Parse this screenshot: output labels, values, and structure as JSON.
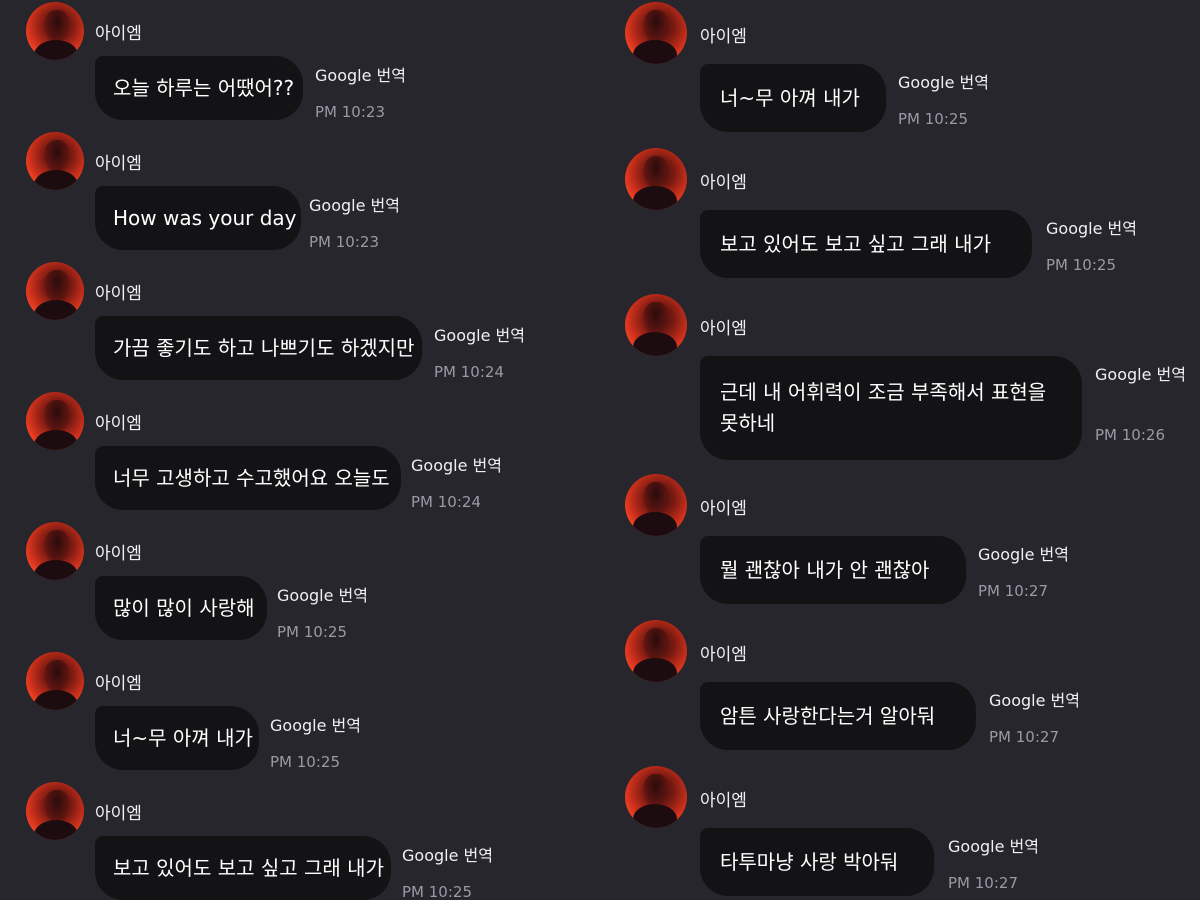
{
  "left_messages": [
    {
      "sender": "아이엠",
      "text": "오늘 하루는 어땠어??",
      "translate": "Google 번역",
      "time": "PM 10:23"
    },
    {
      "sender": "아이엠",
      "text": "How was your day",
      "translate": "Google 번역",
      "time": "PM 10:23"
    },
    {
      "sender": "아이엠",
      "text": "가끔 좋기도 하고 나쁘기도 하겠지만",
      "translate": "Google 번역",
      "time": "PM 10:24"
    },
    {
      "sender": "아이엠",
      "text": "너무 고생하고 수고했어요 오늘도",
      "translate": "Google 번역",
      "time": "PM 10:24"
    },
    {
      "sender": "아이엠",
      "text": "많이 많이 사랑해",
      "translate": "Google 번역",
      "time": "PM 10:25"
    },
    {
      "sender": "아이엠",
      "text": "너~무 아껴 내가",
      "translate": "Google 번역",
      "time": "PM 10:25"
    },
    {
      "sender": "아이엠",
      "text": "보고 있어도 보고 싶고 그래 내가",
      "translate": "Google 번역",
      "time": "PM 10:25"
    }
  ],
  "right_messages": [
    {
      "sender": "아이엠",
      "text": "너~무 아껴 내가",
      "translate": "Google 번역",
      "time": "PM 10:25"
    },
    {
      "sender": "아이엠",
      "text": "보고 있어도 보고 싶고 그래 내가",
      "translate": "Google 번역",
      "time": "PM 10:25"
    },
    {
      "sender": "아이엠",
      "text": "근데 내 어휘력이 조금 부족해서 표현을 못하네",
      "translate": "Google 번역",
      "time": "PM 10:26"
    },
    {
      "sender": "아이엠",
      "text": "뭘 괜찮아 내가 안 괜찮아",
      "translate": "Google 번역",
      "time": "PM 10:27"
    },
    {
      "sender": "아이엠",
      "text": "암튼 사랑한다는거 알아둬",
      "translate": "Google 번역",
      "time": "PM 10:27"
    },
    {
      "sender": "아이엠",
      "text": "타투마냥 사랑 박아둬",
      "translate": "Google 번역",
      "time": "PM 10:27"
    }
  ]
}
